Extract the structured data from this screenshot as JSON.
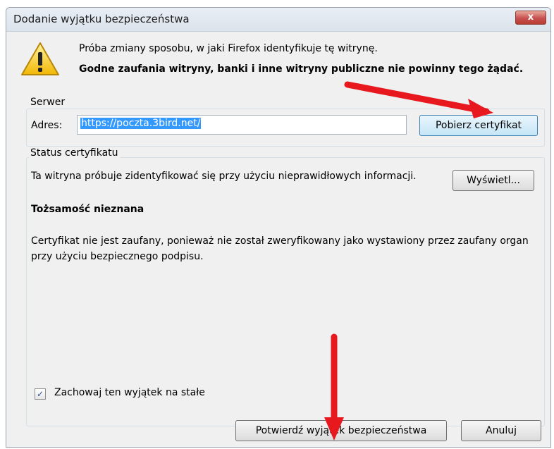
{
  "dialog": {
    "title": "Dodanie wyjątku bezpieczeństwa",
    "close_label": "x",
    "message_intro": "Próba zmiany sposobu, w jaki Firefox identyfikuje tę witrynę.",
    "message_warning": "Godne zaufania witryny, banki i inne witryny publiczne nie powinny tego żądać."
  },
  "server": {
    "group_label": "Serwer",
    "address_label": "Adres:",
    "address_value": "https://poczta.3bird.net/",
    "get_cert_label": "Pobierz certyfikat"
  },
  "status": {
    "group_label": "Status certyfikatu",
    "description": "Ta witryna próbuje zidentyfikować się przy użyciu nieprawidłowych informacji.",
    "view_label": "Wyświetl...",
    "identity": "Tożsamość nieznana",
    "cert_detail": "Certyfikat nie jest zaufany, ponieważ nie został zweryfikowany jako wystawiony przez zaufany organ przy użyciu bezpiecznego podpisu."
  },
  "options": {
    "permanent_label": "Zachowaj ten wyjątek na stałe",
    "permanent_checked": true
  },
  "buttons": {
    "confirm_label": "Potwierdź wyjątek bezpieczeństwa",
    "cancel_label": "Anuluj"
  },
  "colors": {
    "annotation_arrow": "#e8191e",
    "selection": "#3399ff"
  }
}
